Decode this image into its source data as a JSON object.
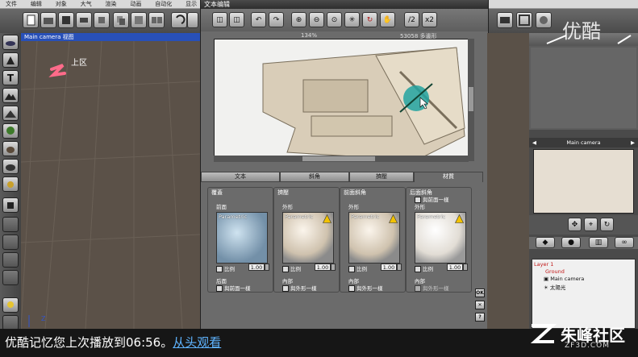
{
  "menu": [
    "文件",
    "编辑",
    "对象",
    "大气",
    "渲染",
    "动画",
    "自动化",
    "显示"
  ],
  "viewport": {
    "title": "Main camera 视图",
    "overlay_logo_text": "上区"
  },
  "dialog": {
    "title": "文本编辑",
    "zoom": "134%",
    "vertex_count": "53058 多邊形",
    "tools": {
      "x2": "x2",
      "half": "/2"
    },
    "tabs": [
      "文本",
      "斜角",
      "擠壓",
      "材質"
    ],
    "active_tab": "材質",
    "groups": [
      {
        "title": "覆蓋",
        "top_label": "前面",
        "tile_label": "Parametric",
        "ratio_label": "比例",
        "ratio": "1.00",
        "bottom_label": "后面",
        "check_label": "與前面一樣",
        "style": "texture"
      },
      {
        "title": "擠壓",
        "top_label": "外形",
        "tile_label": "Parametric",
        "ratio_label": "比例",
        "ratio": "1.00",
        "bottom_label": "內部",
        "check_label": "與外形一樣",
        "style": "sphere"
      },
      {
        "title": "前面斜角",
        "top_label": "外形",
        "tile_label": "Parametric",
        "ratio_label": "比例",
        "ratio": "1.00",
        "bottom_label": "內部",
        "check_label": "與外形一樣",
        "style": "sphere"
      },
      {
        "title": "后面斜角",
        "check_top": "與前面一樣",
        "top_label": "外形",
        "tile_label": "Parametric",
        "ratio_label": "比例",
        "ratio": "1.00",
        "bottom_label": "內部",
        "check_label": "與外形一樣",
        "style": "sphere-light"
      }
    ],
    "side_buttons": [
      "OK",
      "✕",
      "?"
    ]
  },
  "right_panel": {
    "camera_label": "Main camera",
    "layers": [
      {
        "name": "Layer 1",
        "indent": 0,
        "color": "#c21818"
      },
      {
        "name": "Ground",
        "indent": 1,
        "color": "#c21818"
      },
      {
        "name": "Main camera",
        "indent": 1,
        "color": "#111111"
      },
      {
        "name": "太陽光",
        "indent": 1,
        "color": "#111111"
      }
    ]
  },
  "banner": {
    "resume_text": "优酷记忆您上次播放到06:56。",
    "link_text": "从头观看"
  },
  "brand": {
    "name": "朱峰社区",
    "site": "ZF3D.COM",
    "youku_logo": "优酷"
  }
}
